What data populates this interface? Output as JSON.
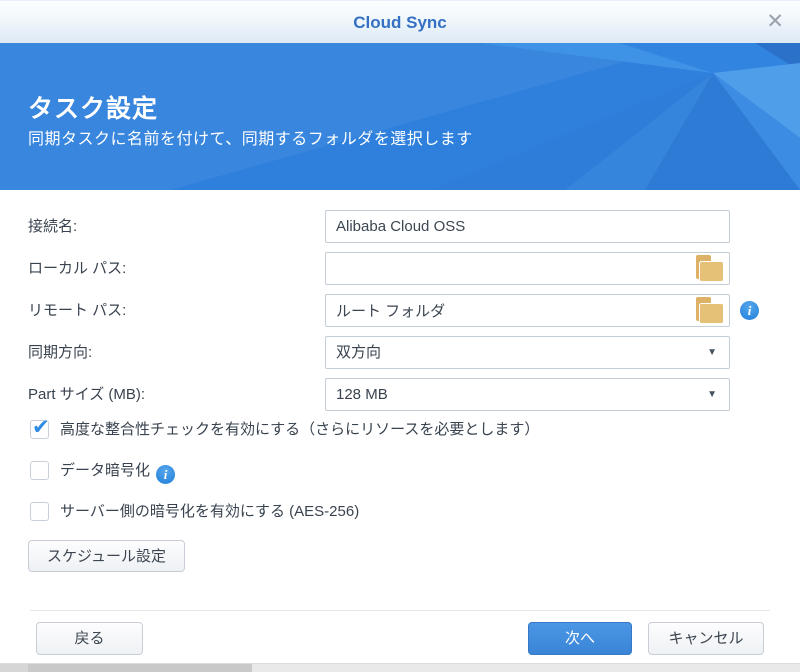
{
  "titlebar": {
    "title": "Cloud Sync"
  },
  "banner": {
    "title": "タスク設定",
    "subtitle": "同期タスクに名前を付けて、同期するフォルダを選択します"
  },
  "form": {
    "fields": [
      {
        "label": "接続名:",
        "value": "Alibaba Cloud OSS",
        "type": "text"
      },
      {
        "label": "ローカル パス:",
        "value": "",
        "type": "folder"
      },
      {
        "label": "リモート パス:",
        "value": "ルート フォルダ",
        "type": "folder-info"
      },
      {
        "label": "同期方向:",
        "value": "双方向",
        "type": "select"
      },
      {
        "label": "Part サイズ (MB):",
        "value": "128 MB",
        "type": "select"
      }
    ],
    "checkboxes": [
      {
        "label": "高度な整合性チェックを有効にする（さらにリソースを必要とします）",
        "checked": true,
        "info": false
      },
      {
        "label": "データ暗号化",
        "checked": false,
        "info": true
      },
      {
        "label": "サーバー側の暗号化を有効にする (AES-256)",
        "checked": false,
        "info": false
      }
    ],
    "schedule_button": "スケジュール設定"
  },
  "footer": {
    "back": "戻る",
    "next": "次へ",
    "cancel": "キャンセル"
  },
  "icons": {
    "close": "✕",
    "dropdown_arrow": "▼",
    "check": "✔",
    "info": "i"
  },
  "colors": {
    "accent_blue": "#3a84d6",
    "banner_blue": "#2e80dc",
    "title_blue": "#3471c4",
    "folder_tan": "#e5c077",
    "info_blue": "#2f8adf",
    "check_blue": "#2f8ce4"
  }
}
